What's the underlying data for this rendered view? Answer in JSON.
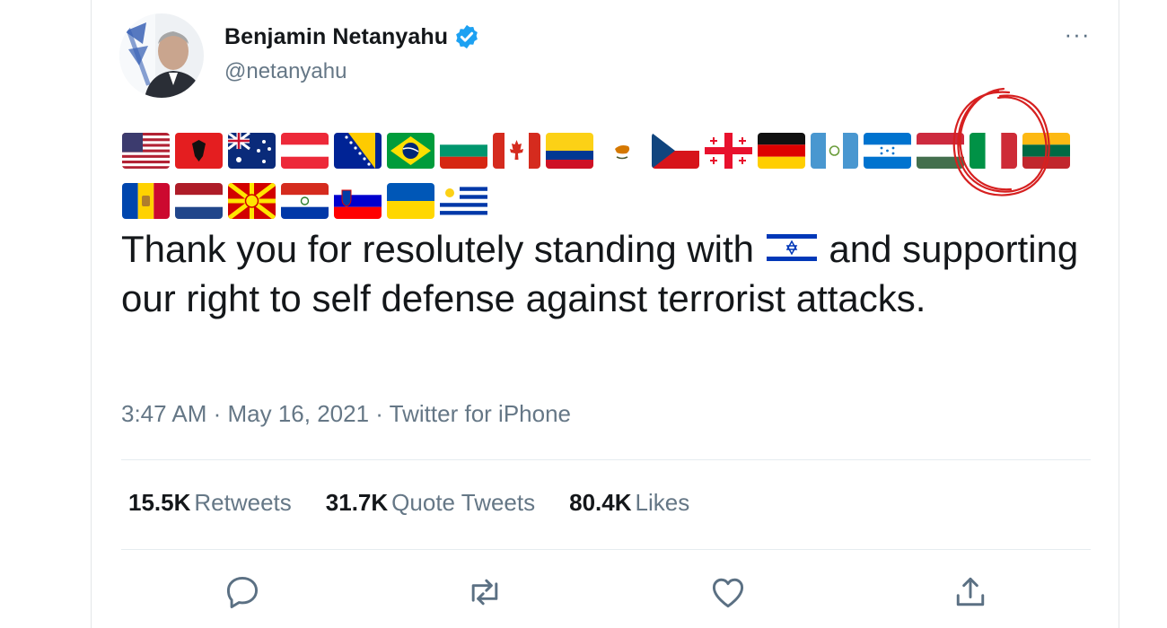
{
  "tweet": {
    "author_name": "Benjamin Netanyahu",
    "author_handle": "@netanyahu",
    "verified": true,
    "text_before_flag": "Thank you for resolutely standing with ",
    "text_after_flag": " and supporting our right to self defense against terrorist attacks.",
    "inline_flag": "flag-israel",
    "timestamp": "3:47 AM · May 16, 2021 · Twitter for iPhone"
  },
  "flags_row1": [
    "flag-usa",
    "flag-albania",
    "flag-australia",
    "flag-austria",
    "flag-bosnia",
    "flag-brazil",
    "flag-bulgaria",
    "flag-canada",
    "flag-colombia",
    "flag-cyprus",
    "flag-czechia",
    "flag-georgia",
    "flag-germany",
    "flag-guatemala",
    "flag-honduras",
    "flag-hungary",
    "flag-italy",
    "flag-lithuania"
  ],
  "flags_row2": [
    "flag-moldova",
    "flag-netherlands",
    "flag-north-macedonia",
    "flag-paraguay",
    "flag-slovenia",
    "flag-ukraine",
    "flag-uruguay"
  ],
  "stats": {
    "retweets_count": "15.5K",
    "retweets_label": "Retweets",
    "quotes_count": "31.7K",
    "quotes_label": "Quote Tweets",
    "likes_count": "80.4K",
    "likes_label": "Likes"
  },
  "icons": {
    "more": "more-icon",
    "verified": "verified-badge-icon",
    "reply": "reply-icon",
    "retweet": "retweet-icon",
    "like": "like-icon",
    "share": "share-icon"
  },
  "colors": {
    "text": "#14171a",
    "secondary": "#657786",
    "verified": "#1da1f2",
    "annotation": "#d62020",
    "action_icon": "#5b7083"
  },
  "ui": {
    "more_glyph": "···"
  }
}
